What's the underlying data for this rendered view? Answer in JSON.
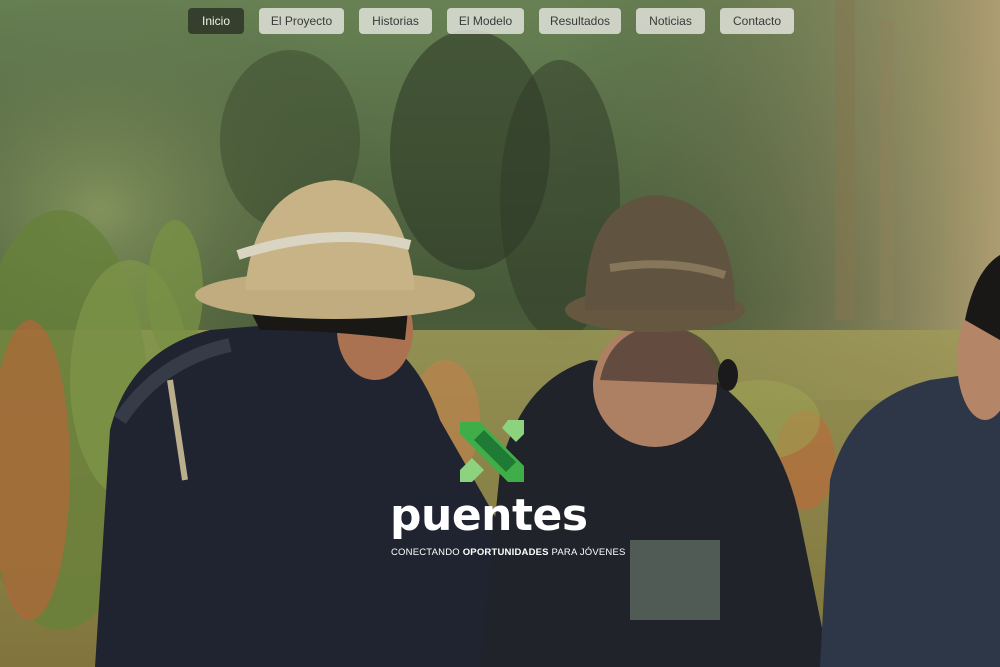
{
  "nav": {
    "items": [
      {
        "label": "Inicio",
        "active": true
      },
      {
        "label": "El Proyecto",
        "active": false
      },
      {
        "label": "Historias",
        "active": false
      },
      {
        "label": "El Modelo",
        "active": false
      },
      {
        "label": "Resultados",
        "active": false
      },
      {
        "label": "Noticias",
        "active": false
      },
      {
        "label": "Contacto",
        "active": false
      }
    ]
  },
  "hero": {
    "image_subject": "three people in hats and ponchos seated in a quinoa field",
    "logo": {
      "wordmark": "puentes",
      "tagline_part1": "CONECTANDO ",
      "tagline_part2": "OPORTUNIDADES",
      "tagline_part3": " PARA JÓVENES",
      "mark_colors": [
        "#3fae49",
        "#1f7a35",
        "#8cd27f"
      ]
    }
  },
  "colors": {
    "nav_active_bg": "#2d3728",
    "nav_bg": "#ebebe6",
    "logo_text": "#ffffff"
  }
}
